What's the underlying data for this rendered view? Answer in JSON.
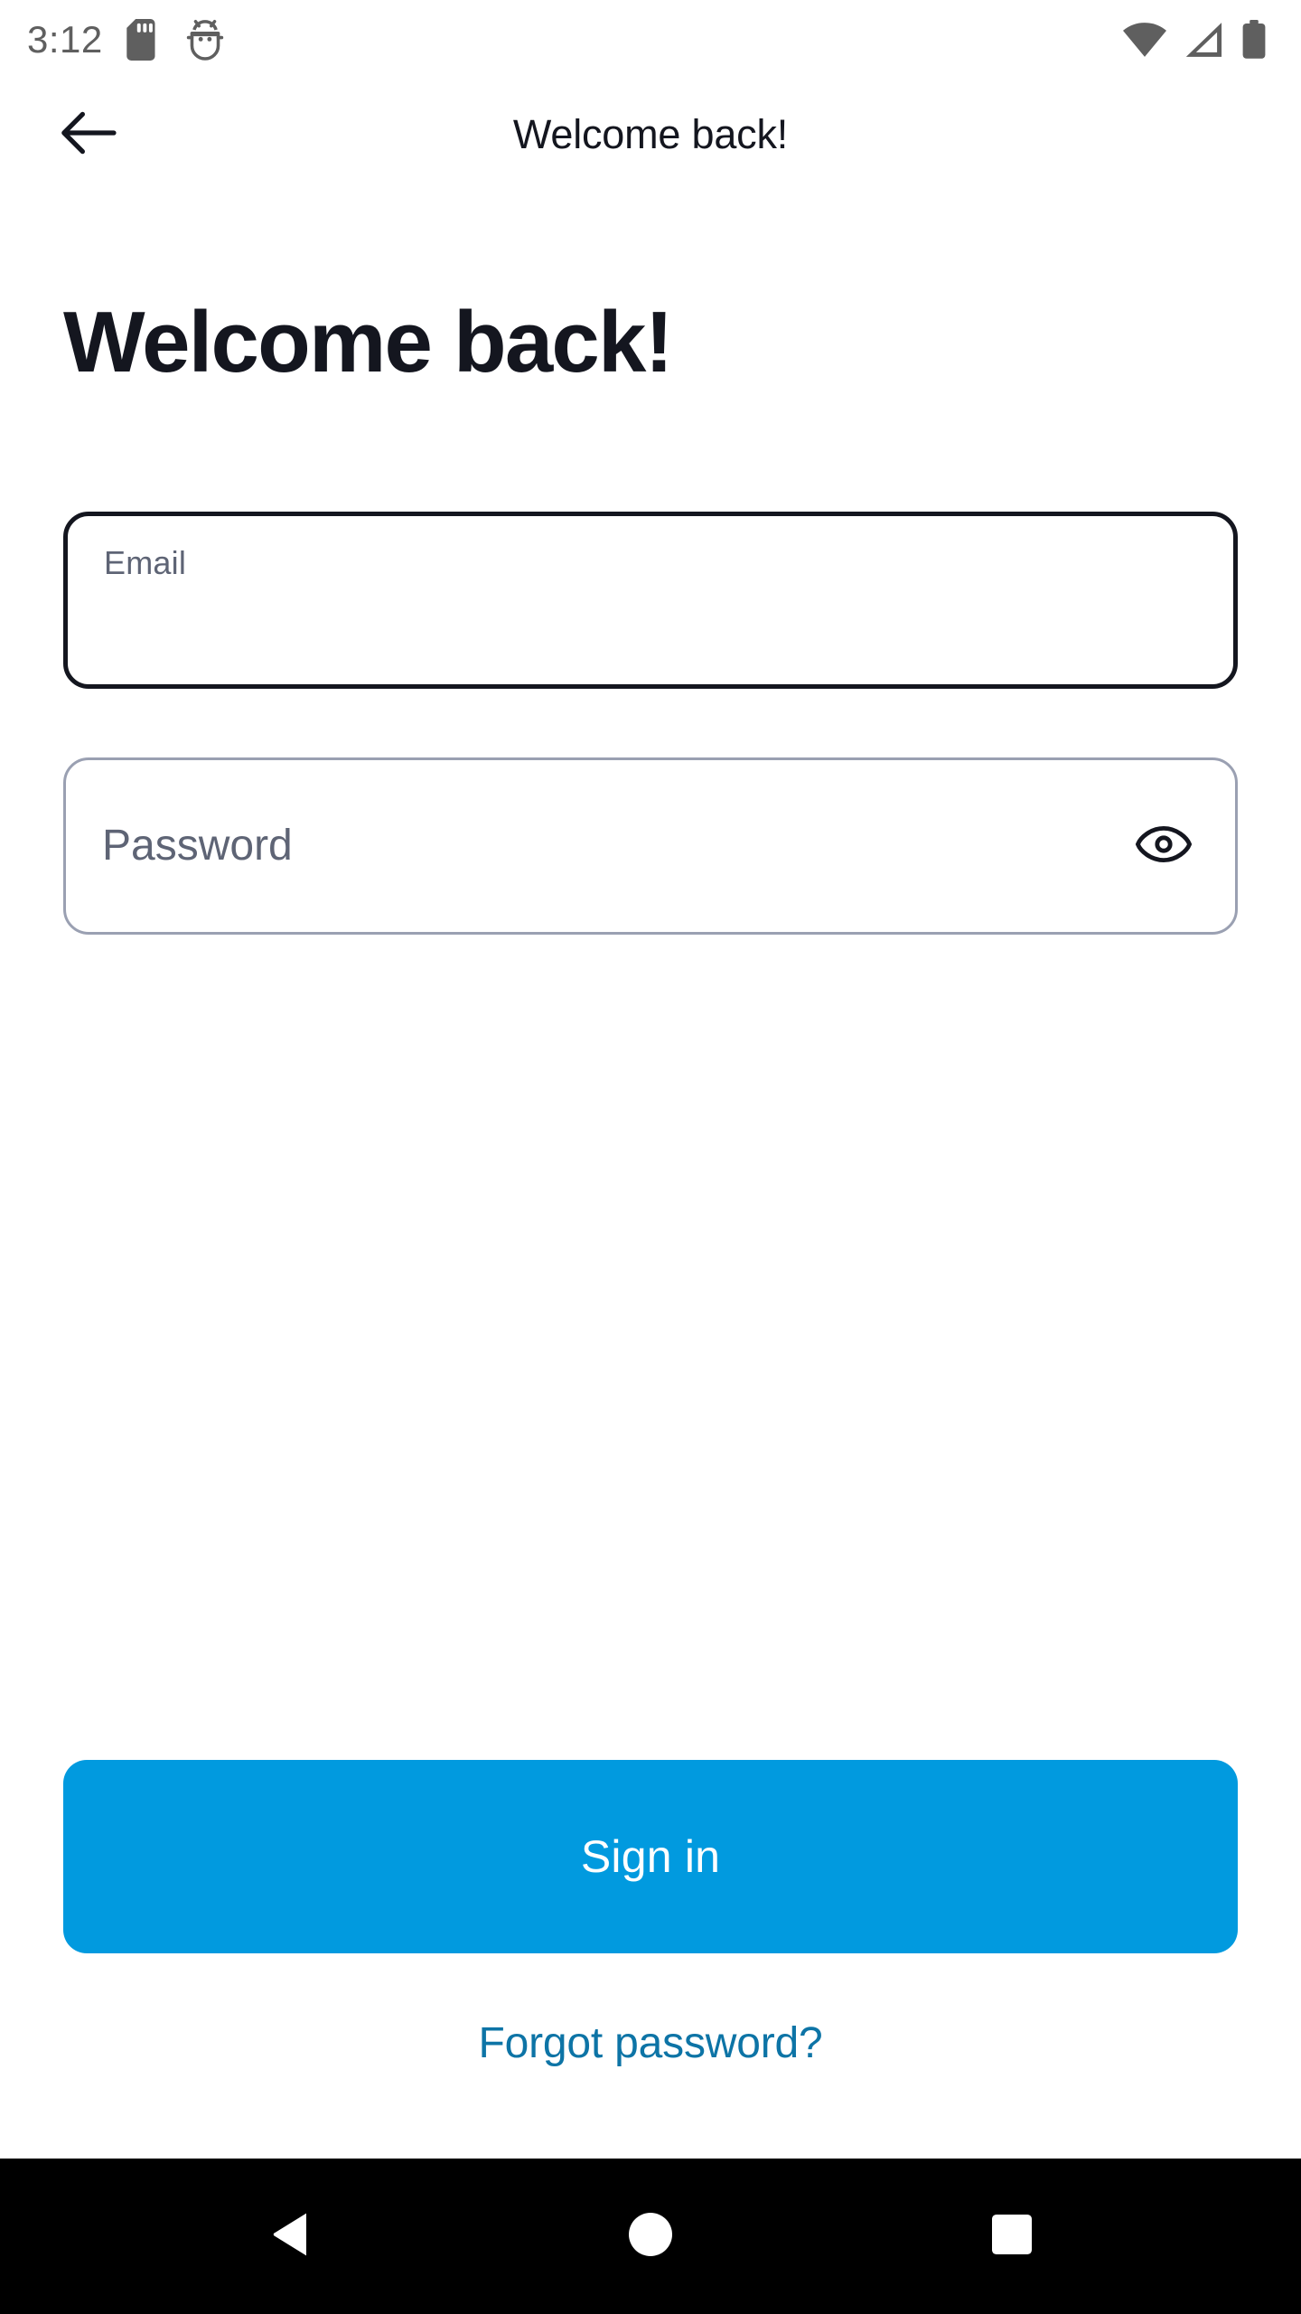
{
  "status_bar": {
    "time": "3:12",
    "left_icons": [
      "sd-card-icon",
      "android-bug-icon"
    ],
    "right_icons": [
      "wifi-icon",
      "cellular-signal-icon",
      "battery-icon"
    ]
  },
  "app_bar": {
    "back_icon": "arrow-left-icon",
    "title": "Welcome back!"
  },
  "main": {
    "headline": "Welcome back!",
    "email_field": {
      "label": "Email",
      "value": "",
      "placeholder": ""
    },
    "password_field": {
      "label": "Password",
      "value": "",
      "placeholder": "Password",
      "toggle_icon": "eye-icon"
    },
    "sign_in_button": "Sign in",
    "forgot_password_link": "Forgot password?"
  },
  "nav_bar": {
    "back": "back-triangle-icon",
    "home": "home-circle-icon",
    "recents": "recents-square-icon"
  },
  "colors": {
    "accent_button": "#019adf",
    "link": "#0d74a6",
    "text_primary": "#14161f",
    "text_muted": "#5e6475",
    "field_border_focused": "#14161f",
    "field_border_default": "#9aa0b2",
    "status_icon": "#5f5f5f",
    "nav_bar_background": "#000000"
  }
}
